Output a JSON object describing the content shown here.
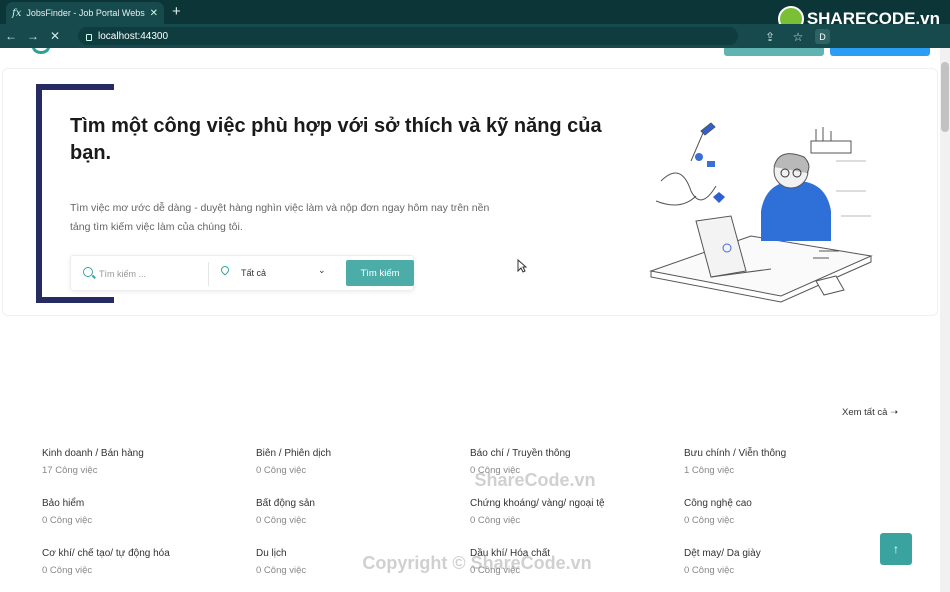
{
  "browser": {
    "tab_title": "JobsFinder - Job Portal Website T",
    "tab_favicon": "fx",
    "new_tab": "+",
    "url": "localhost:44300",
    "ext_labels": [
      "D"
    ],
    "brand_logo_text": "SHARECODE.vn"
  },
  "hero": {
    "title": "Tìm một công việc phù hợp với sở thích và kỹ năng của bạn.",
    "description": "Tìm việc mơ ước dễ dàng - duyệt hàng nghìn việc làm và nộp đơn ngay hôm nay trên nền tảng tìm kiếm việc làm của chúng tôi.",
    "search": {
      "placeholder": "Tìm kiếm ...",
      "location_selected": "Tất cả",
      "button_label": "Tìm kiếm"
    }
  },
  "categories": {
    "see_all": "Xem tất cả",
    "items": [
      {
        "name": "Kinh doanh / Bán hàng",
        "count": "17 Công việc"
      },
      {
        "name": "Biên / Phiên dịch",
        "count": "0 Công việc"
      },
      {
        "name": "Báo chí / Truyền thông",
        "count": "0 Công việc"
      },
      {
        "name": "Bưu chính / Viễn thông",
        "count": "1 Công việc"
      },
      {
        "name": "Bảo hiểm",
        "count": "0 Công việc"
      },
      {
        "name": "Bất động sản",
        "count": "0 Công việc"
      },
      {
        "name": "Chứng khoáng/ vàng/ ngoại tệ",
        "count": "0 Công việc"
      },
      {
        "name": "Công nghệ cao",
        "count": "0 Công việc"
      },
      {
        "name": "Cơ khí/ chế tạo/ tự động hóa",
        "count": "0 Công việc"
      },
      {
        "name": "Du lịch",
        "count": "0 Công việc"
      },
      {
        "name": "Dầu khí/ Hóa chất",
        "count": "0 Công việc"
      },
      {
        "name": "Dệt may/ Da giày",
        "count": "0 Công việc"
      }
    ]
  },
  "watermarks": [
    "ShareCode.vn",
    "Copyright © ShareCode.vn"
  ],
  "colors": {
    "accent": "#4cada8",
    "bracket": "#262b62",
    "chrome": "#0c3537"
  }
}
